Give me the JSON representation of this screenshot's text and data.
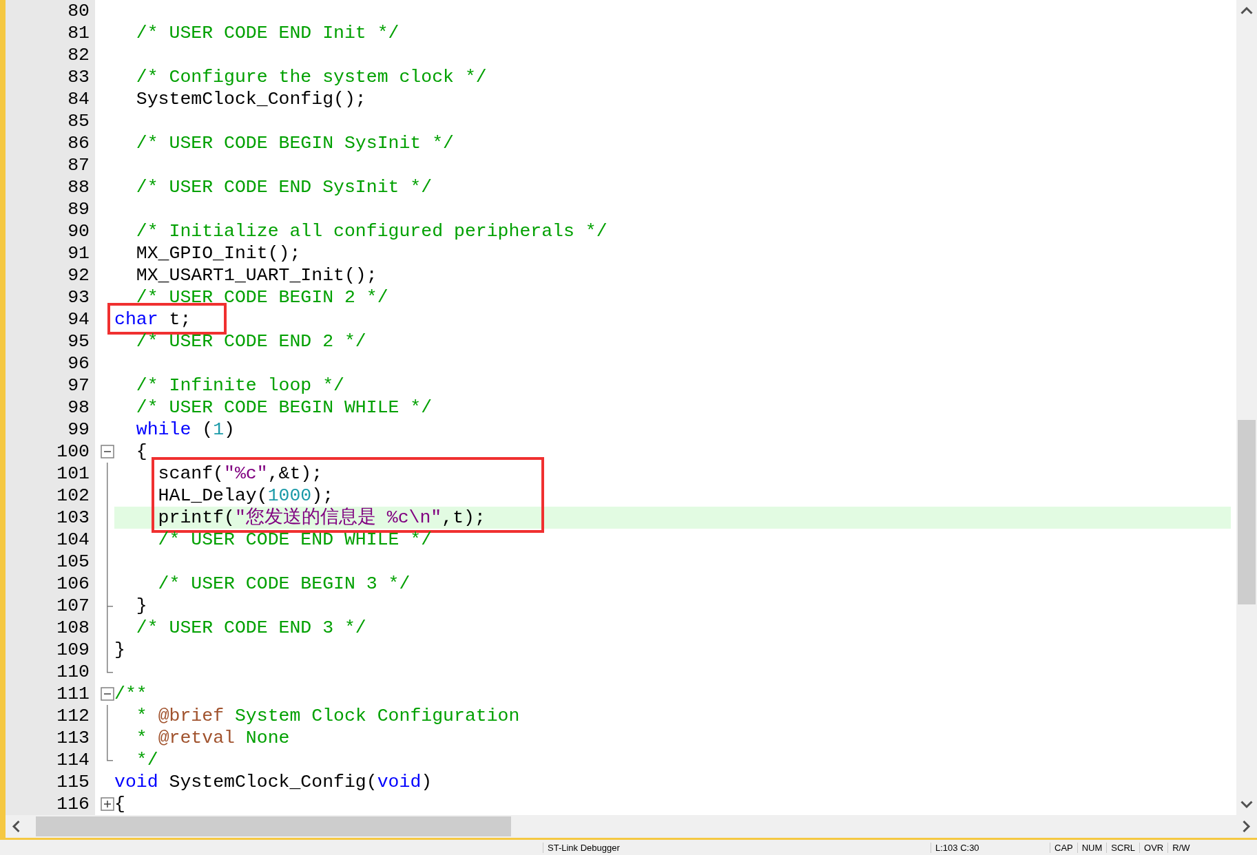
{
  "lines": [
    {
      "num": "80"
    },
    {
      "num": "81",
      "tokens": [
        {
          "t": "  /* USER CODE END Init */",
          "kind": "comment"
        }
      ]
    },
    {
      "num": "82"
    },
    {
      "num": "83",
      "tokens": [
        {
          "t": "  /* Configure the system clock */",
          "kind": "comment"
        }
      ]
    },
    {
      "num": "84",
      "tokens": [
        {
          "t": "  SystemClock_Config();",
          "kind": "plain"
        }
      ]
    },
    {
      "num": "85"
    },
    {
      "num": "86",
      "tokens": [
        {
          "t": "  /* USER CODE BEGIN SysInit */",
          "kind": "comment"
        }
      ]
    },
    {
      "num": "87"
    },
    {
      "num": "88",
      "tokens": [
        {
          "t": "  /* USER CODE END SysInit */",
          "kind": "comment"
        }
      ]
    },
    {
      "num": "89"
    },
    {
      "num": "90",
      "tokens": [
        {
          "t": "  /* Initialize all configured peripherals */",
          "kind": "comment"
        }
      ]
    },
    {
      "num": "91",
      "tokens": [
        {
          "t": "  MX_GPIO_Init();",
          "kind": "plain"
        }
      ]
    },
    {
      "num": "92",
      "tokens": [
        {
          "t": "  MX_USART1_UART_Init();",
          "kind": "plain"
        }
      ]
    },
    {
      "num": "93",
      "tokens": [
        {
          "t": "  /* USER CODE BEGIN 2 */",
          "kind": "comment"
        }
      ]
    },
    {
      "num": "94",
      "boxed": true,
      "tokens": [
        {
          "t": "char",
          "kind": "keyword"
        },
        {
          "t": " t;",
          "kind": "plain"
        }
      ]
    },
    {
      "num": "95",
      "tokens": [
        {
          "t": "  /* USER CODE END 2 */",
          "kind": "comment"
        }
      ]
    },
    {
      "num": "96"
    },
    {
      "num": "97",
      "tokens": [
        {
          "t": "  /* Infinite loop */",
          "kind": "comment"
        }
      ]
    },
    {
      "num": "98",
      "tokens": [
        {
          "t": "  /* USER CODE BEGIN WHILE */",
          "kind": "comment"
        }
      ]
    },
    {
      "num": "99",
      "tokens": [
        {
          "t": "  while",
          "kind": "keyword"
        },
        {
          "t": " (",
          "kind": "plain"
        },
        {
          "t": "1",
          "kind": "number"
        },
        {
          "t": ")",
          "kind": "plain"
        }
      ]
    },
    {
      "num": "100",
      "fold": {
        "kind": "open"
      },
      "tokens": [
        {
          "t": "  {",
          "kind": "plain"
        }
      ]
    },
    {
      "num": "101",
      "fold": {
        "kind": "line"
      },
      "boxed": true,
      "tokens": [
        {
          "t": "    scanf(",
          "kind": "plain"
        },
        {
          "t": "\"%c\"",
          "kind": "string"
        },
        {
          "t": ",&t);",
          "kind": "plain"
        }
      ]
    },
    {
      "num": "102",
      "fold": {
        "kind": "line"
      },
      "boxed": true,
      "tokens": [
        {
          "t": "    HAL_Delay(",
          "kind": "plain"
        },
        {
          "t": "1000",
          "kind": "number"
        },
        {
          "t": ");",
          "kind": "plain"
        }
      ]
    },
    {
      "num": "103",
      "fold": {
        "kind": "line"
      },
      "boxed": true,
      "current": true,
      "tokens": [
        {
          "t": "    printf(",
          "kind": "plain"
        },
        {
          "t": "\"您发送的信息是 %c\\n\"",
          "kind": "string"
        },
        {
          "t": ",t);",
          "kind": "plain"
        }
      ]
    },
    {
      "num": "104",
      "fold": {
        "kind": "line"
      },
      "tokens": [
        {
          "t": "    /* USER CODE END WHILE */",
          "kind": "comment"
        }
      ]
    },
    {
      "num": "105",
      "fold": {
        "kind": "line"
      }
    },
    {
      "num": "106",
      "fold": {
        "kind": "line"
      },
      "tokens": [
        {
          "t": "    /* USER CODE BEGIN 3 */",
          "kind": "comment"
        }
      ]
    },
    {
      "num": "107",
      "fold": {
        "kind": "tick"
      },
      "tokens": [
        {
          "t": "  }",
          "kind": "plain"
        }
      ]
    },
    {
      "num": "108",
      "fold": {
        "kind": "line"
      },
      "tokens": [
        {
          "t": "  /* USER CODE END 3 */",
          "kind": "comment"
        }
      ]
    },
    {
      "num": "109",
      "fold": {
        "kind": "line"
      },
      "tokens": [
        {
          "t": "}",
          "kind": "plain"
        }
      ]
    },
    {
      "num": "110",
      "fold": {
        "kind": "end"
      }
    },
    {
      "num": "111",
      "fold": {
        "kind": "open"
      },
      "tokens": [
        {
          "t": "/**",
          "kind": "comment"
        }
      ]
    },
    {
      "num": "112",
      "fold": {
        "kind": "line"
      },
      "tokens": [
        {
          "t": "  * ",
          "kind": "comment"
        },
        {
          "t": "@brief",
          "kind": "doctag"
        },
        {
          "t": " System Clock Configuration",
          "kind": "comment"
        }
      ]
    },
    {
      "num": "113",
      "fold": {
        "kind": "line"
      },
      "tokens": [
        {
          "t": "  * ",
          "kind": "comment"
        },
        {
          "t": "@retval",
          "kind": "doctag"
        },
        {
          "t": " None",
          "kind": "comment"
        }
      ]
    },
    {
      "num": "114",
      "fold": {
        "kind": "end"
      },
      "tokens": [
        {
          "t": "  */",
          "kind": "comment"
        }
      ]
    },
    {
      "num": "115",
      "tokens": [
        {
          "t": "void",
          "kind": "keyword"
        },
        {
          "t": " SystemClock_Config(",
          "kind": "plain"
        },
        {
          "t": "void",
          "kind": "keyword"
        },
        {
          "t": ")",
          "kind": "plain"
        }
      ]
    },
    {
      "num": "116",
      "fold": {
        "kind": "closed"
      },
      "tokens": [
        {
          "t": "{",
          "kind": "plain"
        }
      ]
    }
  ],
  "status_bar": [
    "ST-Link Debugger",
    "L:103 C:30",
    "CAP",
    "NUM",
    "SCRL",
    "OVR",
    "R/W"
  ]
}
